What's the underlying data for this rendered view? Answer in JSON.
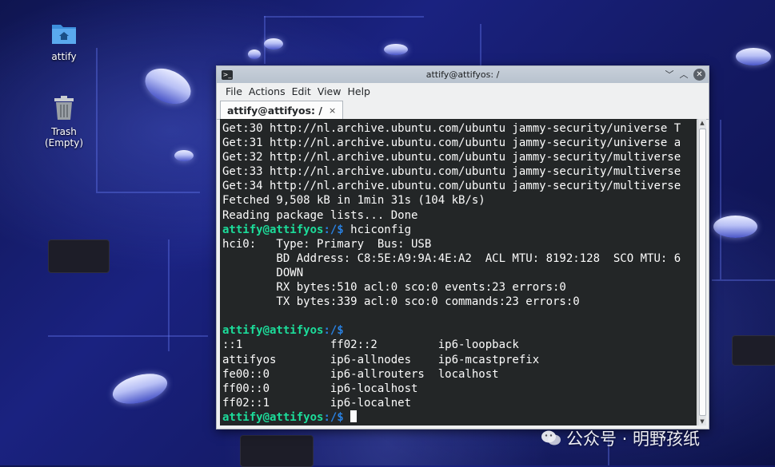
{
  "desktop": {
    "icons": [
      {
        "label": "attify"
      },
      {
        "label": "Trash\n(Empty)"
      }
    ]
  },
  "window": {
    "title": "attify@attifyos: /",
    "controls": {
      "minimize": "﹀",
      "maximize": "︿",
      "close": "✕"
    },
    "menu": [
      "File",
      "Actions",
      "Edit",
      "View",
      "Help"
    ],
    "tab": {
      "label": "attify@attifyos: /",
      "close": "×"
    }
  },
  "terminal": {
    "prompt_user": "attify@attifyos",
    "prompt_path": ":/$",
    "output_block_1": "Get:30 http://nl.archive.ubuntu.com/ubuntu jammy-security/universe T\nGet:31 http://nl.archive.ubuntu.com/ubuntu jammy-security/universe a\nGet:32 http://nl.archive.ubuntu.com/ubuntu jammy-security/multiverse\nGet:33 http://nl.archive.ubuntu.com/ubuntu jammy-security/multiverse\nGet:34 http://nl.archive.ubuntu.com/ubuntu jammy-security/multiverse\nFetched 9,508 kB in 1min 31s (104 kB/s)\nReading package lists... Done",
    "command_1": " hciconfig",
    "output_block_2": "hci0:   Type: Primary  Bus: USB\n        BD Address: C8:5E:A9:9A:4E:A2  ACL MTU: 8192:128  SCO MTU: 6\n        DOWN\n        RX bytes:510 acl:0 sco:0 events:23 errors:0\n        TX bytes:339 acl:0 sco:0 commands:23 errors:0\n",
    "command_2": "",
    "output_block_3": "::1             ff02::2         ip6-loopback\nattifyos        ip6-allnodes    ip6-mcastprefix\nfe00::0         ip6-allrouters  localhost\nff00::0         ip6-localhost\nff02::1         ip6-localnet",
    "command_3": " "
  },
  "watermark": {
    "text": "公众号 · 明野孩纸"
  }
}
